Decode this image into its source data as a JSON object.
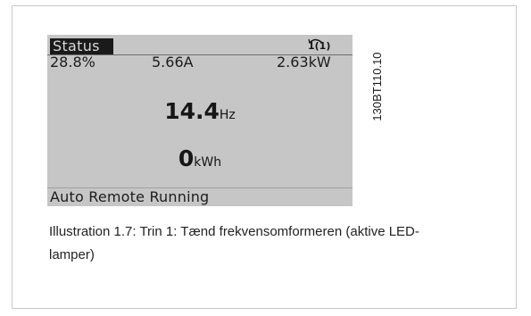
{
  "display": {
    "status_label": "Status",
    "setup_number": "1(1)",
    "readouts": {
      "speed_percent": "28.8%",
      "current": "5.66A",
      "power": "2.63kW"
    },
    "frequency": {
      "value": "14.4",
      "unit": "Hz"
    },
    "energy": {
      "value": "0",
      "unit": "kWh"
    },
    "operating_status": "Auto Remote Running"
  },
  "figure_code": "130BT110.10",
  "caption": "Illustration 1.7: Trin 1: Tænd frekvensomformeren (aktive LED-lamper)"
}
